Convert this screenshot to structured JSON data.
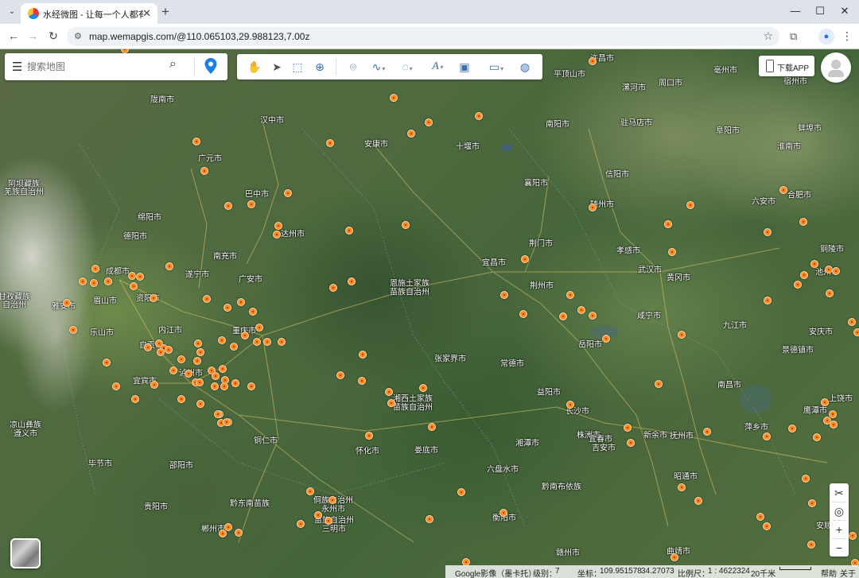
{
  "browser": {
    "tab_title": "水经微图 - 让每一个人都有自己",
    "tab_close": "✕",
    "new_tab": "+",
    "url": "map.wemapgis.com/@110.065103,29.988123,7.00z",
    "window_controls": {
      "minimize": "—",
      "maximize": "☐",
      "close": "✕"
    }
  },
  "search": {
    "placeholder": "搜索地图"
  },
  "toolbar": {
    "tools": [
      "hand-pan",
      "select",
      "select-area",
      "zoom-area",
      "place-marker",
      "draw-line",
      "draw-polygon",
      "text",
      "image",
      "measure",
      "globe"
    ]
  },
  "download": {
    "label": "下载APP"
  },
  "status": {
    "source": "Google影像（墨卡托）",
    "level_label": "级别：",
    "level": "7",
    "coord_label": "坐标：",
    "coord_x": "109.951578",
    "coord_y": "34.27073",
    "scale_label": "比例尺：",
    "scale": "1 : 4622324",
    "scale_bar": "20千米",
    "help": "帮助",
    "about": "关于"
  },
  "map": {
    "labels": [
      "许昌市",
      "平顶山市",
      "漯河市",
      "周口市",
      "亳州市",
      "宿州市",
      "陇南市",
      "汉中市",
      "安康市",
      "十堰市",
      "南阳市",
      "驻马店市",
      "阜阳市",
      "蚌埠市",
      "淮南市",
      "阿坝藏族",
      "羌族自治州",
      "广元市",
      "巴中市",
      "襄阳市",
      "信阳市",
      "六安市",
      "合肥市",
      "绵阳市",
      "达州市",
      "随州市",
      "德阳市",
      "南充市",
      "荆门市",
      "孝感市",
      "宜昌市",
      "铜陵市",
      "成都市",
      "遂宁市",
      "广安市",
      "恩施土家族",
      "苗族自治州",
      "武汉市",
      "黄冈市",
      "池州市",
      "甘孜藏族",
      "自治州",
      "雅安市",
      "眉山市",
      "资阳市",
      "荆州市",
      "乐山市",
      "内江市",
      "重庆市",
      "咸宁市",
      "九江市",
      "安庆市",
      "自贡市",
      "景德镇市",
      "泸州市",
      "张家界市",
      "常德市",
      "岳阳市",
      "宜宾市",
      "湘西土家族",
      "苗族自治州",
      "益阳市",
      "南昌市",
      "上饶市",
      "长沙市",
      "鹰潭市",
      "株洲市",
      "凉山彝族",
      "遵义市",
      "铜仁市",
      "怀化市",
      "娄底市",
      "湘潭市",
      "宜春市",
      "新余市",
      "抚州市",
      "萍乡市",
      "吉安市",
      "昭通市",
      "毕节市",
      "邵阳市",
      "六盘水市",
      "贵阳市",
      "黔东南苗族",
      "侗族自治州",
      "永州市",
      "衡阳市",
      "黔南布依族",
      "苗族自治州",
      "三明市",
      "安顺市",
      "郴州市",
      "赣州市",
      "曲靖市"
    ]
  }
}
